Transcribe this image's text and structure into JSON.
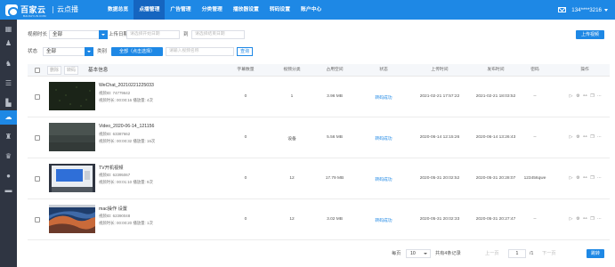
{
  "brand": {
    "name": "百家云",
    "sub": "BAIJIAYUN.COM",
    "product": "云点播"
  },
  "nav": [
    {
      "label": "数据总览"
    },
    {
      "label": "点播管理"
    },
    {
      "label": "广告管理"
    },
    {
      "label": "分类管理"
    },
    {
      "label": "播放器设置"
    },
    {
      "label": "转码设置"
    },
    {
      "label": "账户中心"
    }
  ],
  "active_nav": "点播管理",
  "user": {
    "name": "134****3216"
  },
  "sidebar": [
    {
      "icon": "grid-icon",
      "glyph": "▦"
    },
    {
      "icon": "users-icon",
      "glyph": "♟"
    },
    {
      "icon": "people-icon",
      "glyph": "♞"
    },
    {
      "icon": "list-icon",
      "glyph": "☰"
    },
    {
      "icon": "building-icon",
      "glyph": "▙"
    },
    {
      "icon": "cloud-upload-icon",
      "glyph": "☁"
    },
    {
      "icon": "group-icon",
      "glyph": "♜"
    },
    {
      "icon": "team-icon",
      "glyph": "♛"
    },
    {
      "icon": "person-icon",
      "glyph": "●"
    },
    {
      "icon": "folder-icon",
      "glyph": "▬"
    }
  ],
  "active_sidebar": 5,
  "filters": {
    "duration_label": "视频时长",
    "duration_value": "全部",
    "upload_date_label": "上传日期",
    "start_placeholder": "请选择开始日期",
    "to_label": "到",
    "end_placeholder": "请选择结束日期",
    "upload_button": "上传视频",
    "status_label": "状态",
    "status_value": "全部",
    "category_label": "类别",
    "category_value": "全部（点击选择）",
    "search_placeholder": "请输入视频名称",
    "search_button": "查询"
  },
  "table": {
    "delete_button": "删除",
    "transcode_button": "转码",
    "headers": {
      "basic": "基本信息",
      "subtitle": "字幕数量",
      "category": "视频分类",
      "space": "占用空间",
      "status": "状态",
      "upload_time": "上传时间",
      "publish_time": "发布时间",
      "password": "密码",
      "actions": "操作"
    },
    "rows": [
      {
        "title": "WeChat_20210221225033",
        "id_label": "视频ID:",
        "id": "74779642",
        "duration_label": "视频时长:",
        "duration": "00:00:16",
        "plays_label": "播放量:",
        "plays": "4次",
        "subtitles": "0",
        "category": "1",
        "space": "3.96 MB",
        "status": "转码成功",
        "upload_time": "2021-02-21 17:57:22",
        "publish_time": "2021-02-21 18:03:52",
        "password": "--"
      },
      {
        "title": "Video_2020-06-14_121156",
        "id_label": "视频ID:",
        "id": "63387662",
        "duration_label": "视频时长:",
        "duration": "00:00:32",
        "plays_label": "播放量:",
        "plays": "16次",
        "subtitles": "0",
        "category": "设备",
        "space": "5.56 MB",
        "status": "转码成功",
        "upload_time": "2020-06-14 12:15:26",
        "publish_time": "2020-06-14 13:26:43",
        "password": "--"
      },
      {
        "title": "TV开机视频",
        "id_label": "视频ID:",
        "id": "62395067",
        "duration_label": "视频时长:",
        "duration": "00:01:10",
        "plays_label": "播放量:",
        "plays": "9次",
        "subtitles": "0",
        "category": "12",
        "space": "17.79 MB",
        "status": "转码成功",
        "upload_time": "2020-05-31 20:02:52",
        "publish_time": "2020-05-31 20:28:07",
        "password": "123456qwe"
      },
      {
        "title": "mac操作 设置",
        "id_label": "视频ID:",
        "id": "62390048",
        "duration_label": "视频时长:",
        "duration": "00:00:20",
        "plays_label": "播放量:",
        "plays": "1次",
        "subtitles": "0",
        "category": "12",
        "space": "3.02 MB",
        "status": "转码成功",
        "upload_time": "2020-05-31 20:02:33",
        "publish_time": "2020-05-31 20:27:47",
        "password": "--"
      }
    ]
  },
  "pagination": {
    "per_page_label": "每页",
    "per_page": "10",
    "total": "共有4条记录",
    "prev": "上一页",
    "page": "1",
    "page_sep": "/1",
    "next": "下一页",
    "goto": "跳转"
  },
  "colors": {
    "primary": "#1e88e5",
    "sidebar": "#2f3542",
    "nav_active": "#1565c0"
  }
}
